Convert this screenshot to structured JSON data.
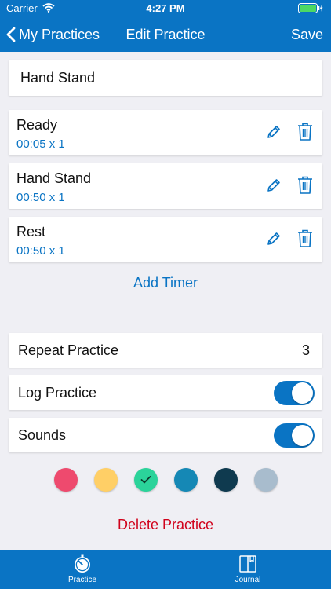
{
  "status_bar": {
    "carrier": "Carrier",
    "time": "4:27 PM"
  },
  "nav": {
    "back_label": "My Practices",
    "title": "Edit Practice",
    "save_label": "Save"
  },
  "practice": {
    "name": "Hand Stand"
  },
  "timers": [
    {
      "name": "Ready",
      "meta": "00:05 x 1"
    },
    {
      "name": "Hand Stand",
      "meta": "00:50 x 1"
    },
    {
      "name": "Rest",
      "meta": "00:50 x 1"
    }
  ],
  "add_timer_label": "Add Timer",
  "settings": {
    "repeat": {
      "label": "Repeat Practice",
      "value": "3"
    },
    "log": {
      "label": "Log Practice",
      "on": true
    },
    "sounds": {
      "label": "Sounds",
      "on": true
    }
  },
  "colors": {
    "accent": "#0a74c4",
    "destructive": "#d0021b",
    "swatches": [
      "#ee4a6e",
      "#ffcf66",
      "#2bd39a",
      "#1588b5",
      "#0f3a4f",
      "#a8bccd"
    ],
    "selected_swatch_index": 2
  },
  "delete_label": "Delete Practice",
  "tabs": [
    {
      "label": "Practice",
      "icon": "stopwatch-icon",
      "active": true
    },
    {
      "label": "Journal",
      "icon": "journal-icon",
      "active": false
    }
  ]
}
